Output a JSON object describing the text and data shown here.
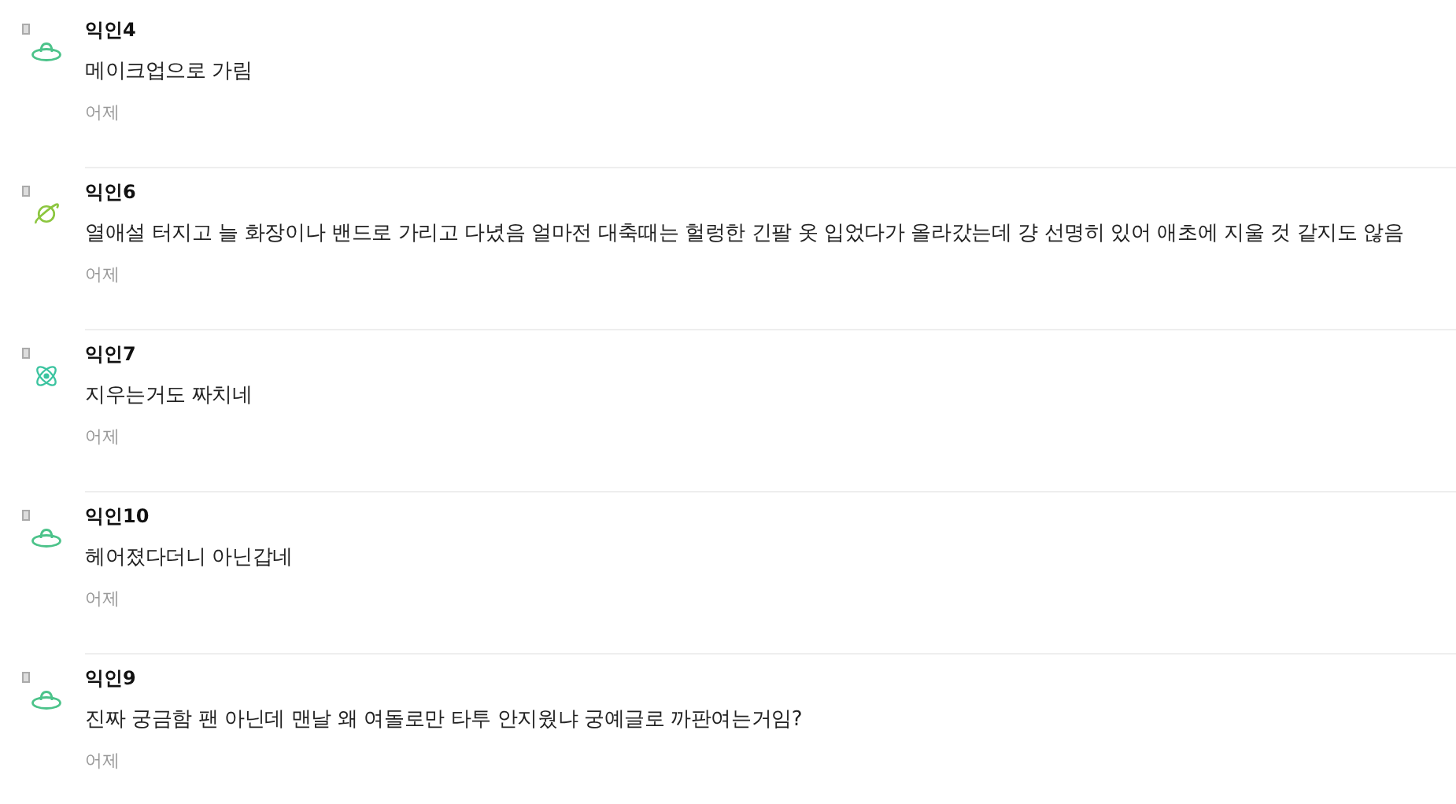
{
  "comments": [
    {
      "author": "익인4",
      "avatar": {
        "kind": "ufo"
      },
      "text": "메이크업으로 가림",
      "time": "어제"
    },
    {
      "author": "익인6",
      "avatar": {
        "kind": "planet"
      },
      "text": "열애설 터지고 늘 화장이나 밴드로 가리고 다녔음 얼마전 대축때는 헐렁한 긴팔 옷 입었다가 올라갔는데 걍 선명히 있어 애초에 지울 것 같지도 않음",
      "time": "어제"
    },
    {
      "author": "익인7",
      "avatar": {
        "kind": "atom"
      },
      "text": "지우는거도 짜치네",
      "time": "어제"
    },
    {
      "author": "익인10",
      "avatar": {
        "kind": "ufo"
      },
      "text": "헤어졌다더니 아닌갑네",
      "time": "어제"
    },
    {
      "author": "익인9",
      "avatar": {
        "kind": "ufo"
      },
      "text": "진짜 궁금함 팬 아닌데 맨날 왜 여돌로만 타투 안지웠냐 궁예글로 까판여는거임?",
      "time": "어제"
    }
  ]
}
